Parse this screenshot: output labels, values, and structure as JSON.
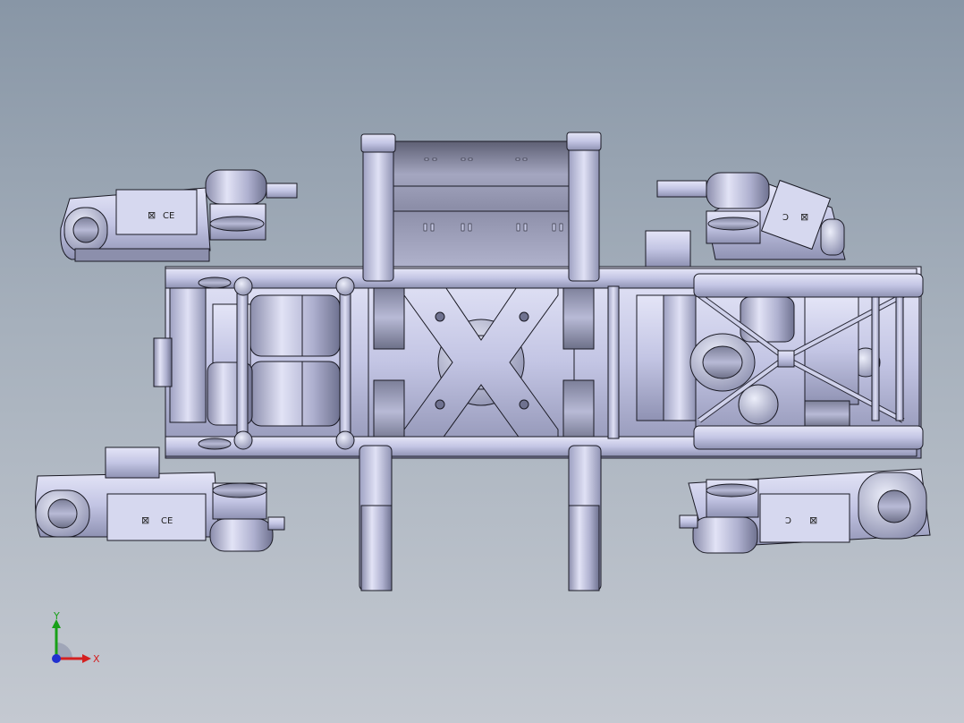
{
  "viewport": {
    "background_top": "#8896a6",
    "background_bottom": "#c4c9d1",
    "model_color": "#c9cbe8",
    "model_shadow": "#8a8dab",
    "edge_color": "#1a1a24"
  },
  "servo": {
    "marks": [
      "CE"
    ]
  },
  "triad": {
    "x_label": "X",
    "y_label": "Y",
    "x_color": "#d42020",
    "y_color": "#18a018",
    "z_color": "#2030d0"
  }
}
